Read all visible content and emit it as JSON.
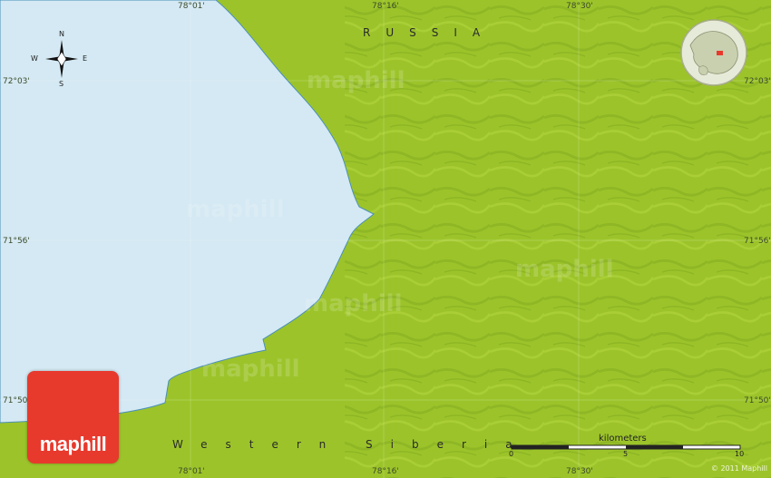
{
  "map": {
    "country_label": "RUSSIA",
    "region_label": "Western Siberia",
    "watermark": "maphill",
    "colors": {
      "land": "#9cc42a",
      "water": "#d4e9f3",
      "coast": "#4a8fb8",
      "logo": "#e8392d"
    }
  },
  "coords": {
    "top": [
      "78°01'",
      "78°16'",
      "78°30'"
    ],
    "bottom": [
      "78°01'",
      "78°16'",
      "78°30'"
    ],
    "left": [
      "72°03'",
      "71°56'",
      "71°50'"
    ],
    "right": [
      "72°03'",
      "71°56'",
      "71°50'"
    ]
  },
  "compass": {
    "n": "N",
    "s": "S",
    "e": "E",
    "w": "W"
  },
  "logo": {
    "text": "maphill"
  },
  "scale": {
    "title": "kilometers",
    "labels": [
      "0",
      "5",
      "10"
    ]
  },
  "copyright": "© 2011 Maphill"
}
